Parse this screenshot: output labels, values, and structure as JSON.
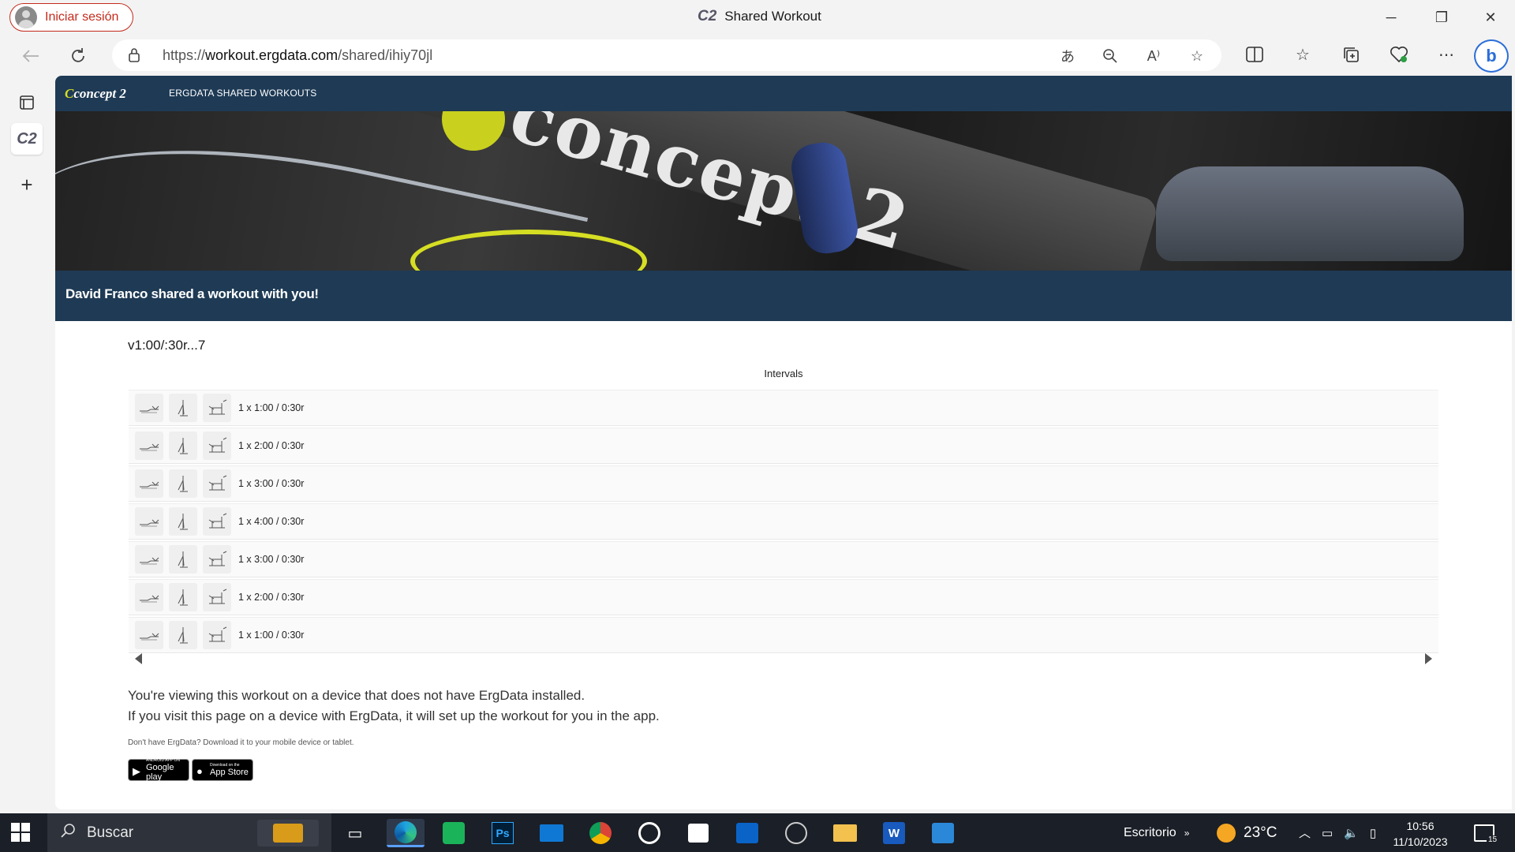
{
  "window": {
    "profile_label": "Iniciar sesión",
    "tab_title": "Shared Workout",
    "tab_favicon": "C2",
    "minimize": "─",
    "restore": "❐",
    "close": "✕"
  },
  "address": {
    "url_prefix": "https://",
    "url_host": "workout.ergdata.com",
    "url_path": "/shared/ihiy70jl"
  },
  "site": {
    "logo_mark": "C",
    "logo_text": "concept 2",
    "header_title": "ERGDATA SHARED WORKOUTS",
    "hero_text": "concept 2",
    "share_message": "David Franco shared a workout with you!"
  },
  "workout": {
    "name": "v1:00/:30r...7",
    "section_title": "Intervals",
    "intervals": [
      {
        "label": "1 x 1:00 / 0:30r"
      },
      {
        "label": "1 x 2:00 / 0:30r"
      },
      {
        "label": "1 x 3:00 / 0:30r"
      },
      {
        "label": "1 x 4:00 / 0:30r"
      },
      {
        "label": "1 x 3:00 / 0:30r"
      },
      {
        "label": "1 x 2:00 / 0:30r"
      },
      {
        "label": "1 x 1:00 / 0:30r"
      }
    ]
  },
  "info": {
    "line1": "You're viewing this workout on a device that does not have ErgData installed.",
    "line2": "If you visit this page on a device with ErgData, it will set up the workout for you in the app.",
    "download_note": "Don't have ErgData? Download it to your mobile device or tablet.",
    "google_badge_top": "ANDROID APP ON",
    "google_badge_main": "Google play",
    "apple_badge_top": "Download on the",
    "apple_badge_main": "App Store"
  },
  "taskbar": {
    "search_placeholder": "Buscar",
    "desktop_label": "Escritorio",
    "temperature": "23°C",
    "time": "10:56",
    "date": "11/10/2023",
    "notifications": "15"
  },
  "colors": {
    "brand_navy": "#1e3a55",
    "brand_yellow": "#d6de23",
    "profile_red": "#c42b1c"
  }
}
